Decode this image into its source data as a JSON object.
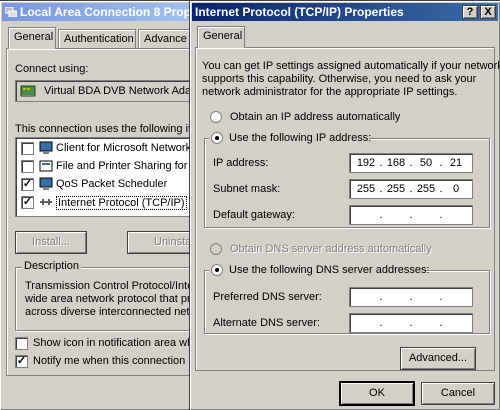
{
  "left_window": {
    "title": "Local Area Connection 8 Prop",
    "tabs": [
      "General",
      "Authentication",
      "Advance"
    ],
    "connect_using_label": "Connect using:",
    "adapter_name": "Virtual BDA DVB Network Ada",
    "components_label": "This connection uses the following ite",
    "components": [
      {
        "label": "Client for Microsoft Network",
        "checked": false
      },
      {
        "label": "File and Printer Sharing for M",
        "checked": false
      },
      {
        "label": "QoS Packet Scheduler",
        "checked": true
      },
      {
        "label": "Internet Protocol (TCP/IP)",
        "checked": true
      }
    ],
    "install_label": "Install...",
    "uninstall_label": "Uninsta",
    "description_title": "Description",
    "description_lines": [
      "Transmission Control Protocol/Inte",
      "wide area network protocol that pr",
      "across diverse interconnected net"
    ],
    "show_icon_label": "Show icon in notification area wh",
    "notify_label": "Notify me when this connection h"
  },
  "right_window": {
    "title": "Internet Protocol (TCP/IP) Properties",
    "help_button": "?",
    "close_button": "X",
    "tab_general": "General",
    "intro_lines": [
      "You can get IP settings assigned automatically if your network",
      "supports this capability. Otherwise, you need to ask your",
      "network administrator for the appropriate IP settings."
    ],
    "obtain_ip_auto": "Obtain an IP address automatically",
    "use_following_ip": "Use the following IP address:",
    "ip_address_label": "IP address:",
    "ip_address": [
      "192",
      "168",
      "50",
      "21"
    ],
    "subnet_mask_label": "Subnet mask:",
    "subnet_mask": [
      "255",
      "255",
      "255",
      "0"
    ],
    "default_gateway_label": "Default gateway:",
    "obtain_dns_auto": "Obtain DNS server address automatically",
    "use_following_dns": "Use the following DNS server addresses:",
    "preferred_dns_label": "Preferred DNS server:",
    "alternate_dns_label": "Alternate DNS server:",
    "advanced_label": "Advanced...",
    "ok_label": "OK",
    "cancel_label": "Cancel"
  }
}
